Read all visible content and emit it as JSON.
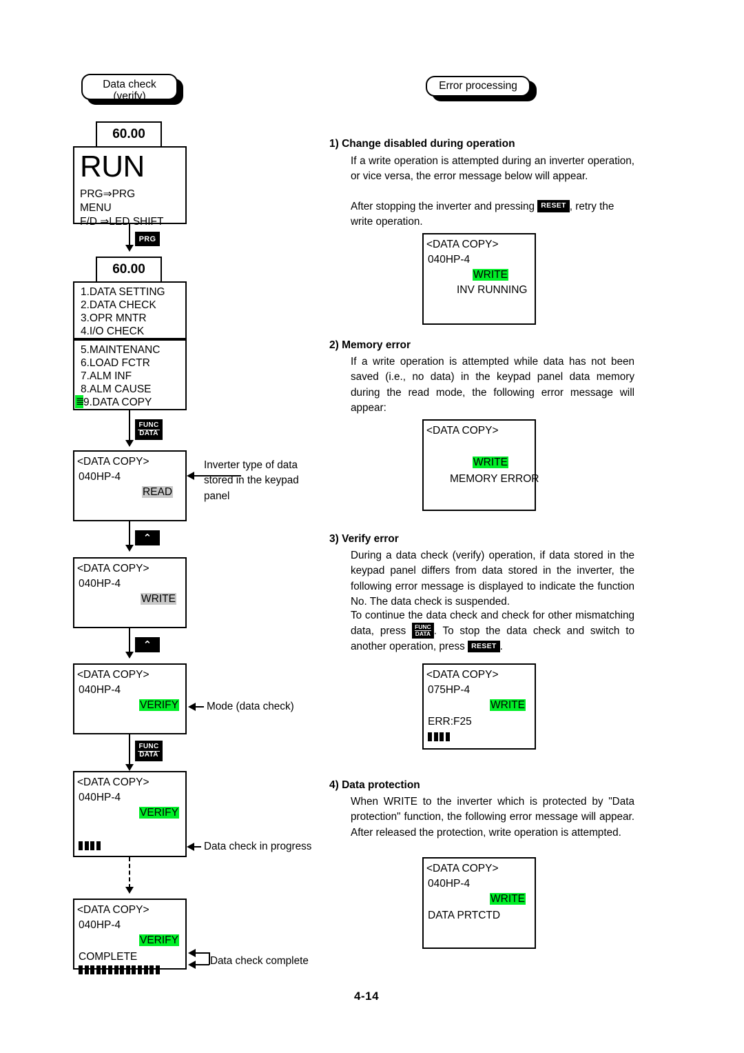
{
  "page": {
    "number": "4-14"
  },
  "colors": {
    "highlight_green": "#00ef27",
    "highlight_gray": "#c8c8c8",
    "key_bg": "#000000"
  },
  "left_column": {
    "banner": {
      "line1": "Data check",
      "line2": "(verify)"
    },
    "screen_run": {
      "tab": "60.00",
      "title": "RUN",
      "line1": "PRG⇒PRG",
      "line2": "MENU",
      "line3": "F/D ⇒LED SHIFT"
    },
    "key_prg": "PRG",
    "screen_menu": {
      "tab": "60.00",
      "group1": [
        "1.DATA SETTING",
        "2.DATA CHECK",
        "3.OPR MNTR",
        "4.I/O CHECK"
      ],
      "group2": [
        "5.MAINTENANC",
        "6.LOAD FCTR",
        "7.ALM INF",
        "8.ALM CAUSE",
        "9.DATA COPY"
      ],
      "cursor_on": "9.DATA COPY"
    },
    "key_func_data": {
      "top": "FUNC",
      "bottom": "DATA"
    },
    "screen_read": {
      "title": "<DATA COPY>",
      "model": "040HP-4",
      "mode": "READ",
      "mode_style": "gray",
      "callout": "Inverter type of data stored in the keypad panel"
    },
    "key_up": "⌃",
    "screen_write": {
      "title": "<DATA COPY>",
      "model": "040HP-4",
      "mode": "WRITE",
      "mode_style": "gray"
    },
    "screen_verify": {
      "title": "<DATA COPY>",
      "model": "040HP-4",
      "mode": "VERIFY",
      "mode_style": "green",
      "callout": "Mode (data check)"
    },
    "screen_progress": {
      "title": "<DATA COPY>",
      "model": "040HP-4",
      "mode": "VERIFY",
      "mode_style": "green",
      "bar_blocks": 4,
      "callout": "Data check in progress"
    },
    "screen_complete": {
      "title": "<DATA COPY>",
      "model": "040HP-4",
      "mode": "VERIFY",
      "mode_style": "green",
      "status": "COMPLETE",
      "bar_blocks": 14,
      "callout": "Data check complete"
    }
  },
  "right_column": {
    "banner": {
      "line1": "Error processing"
    },
    "sections": [
      {
        "heading": "1) Change disabled during operation",
        "para_a": "If a write operation is attempted during an inverter operation, or vice versa, the error message below will appear.",
        "para_b_pre": "After stopping the inverter and pressing",
        "para_b_key": "RESET",
        "para_b_post": ", retry the write operation.",
        "screen": {
          "title": "<DATA COPY>",
          "model": "040HP-4",
          "mode": "WRITE",
          "mode_style": "green",
          "message": "INV RUNNING"
        }
      },
      {
        "heading": "2) Memory error",
        "para_a": "If a write operation is attempted while data has not been saved (i.e., no data) in the keypad panel data memory during the read mode, the following error message will appear:",
        "screen": {
          "title": "<DATA COPY>",
          "model": "",
          "mode": "WRITE",
          "mode_style": "green",
          "message": "MEMORY ERROR"
        }
      },
      {
        "heading": "3) Verify error",
        "para_a": "During a data check (verify) operation, if data stored in the keypad panel differs from data stored in the inverter, the following error message is displayed to indicate the function No.   The data check is suspended.",
        "para_b_pre": "To continue the data check and check for other mismatching data, press",
        "para_b_key1_top": "FUNC",
        "para_b_key1_bot": "DATA",
        "para_b_mid": ".   To stop the data check and switch to another operation, press",
        "para_b_key2": "RESET",
        "para_b_post": ".",
        "screen": {
          "title": "<DATA COPY>",
          "model": "075HP-4",
          "mode": "WRITE",
          "mode_style": "green",
          "message": "ERR:F25",
          "bar_blocks": 4
        }
      },
      {
        "heading": "4) Data protection",
        "para_a": "When WRITE to the inverter which is protected by \"Data protection\" function, the following error message will appear. After released the protection, write operation is attempted.",
        "screen": {
          "title": "<DATA COPY>",
          "model": "040HP-4",
          "mode": "WRITE",
          "mode_style": "green",
          "message": "DATA PRTCTD"
        }
      }
    ]
  }
}
